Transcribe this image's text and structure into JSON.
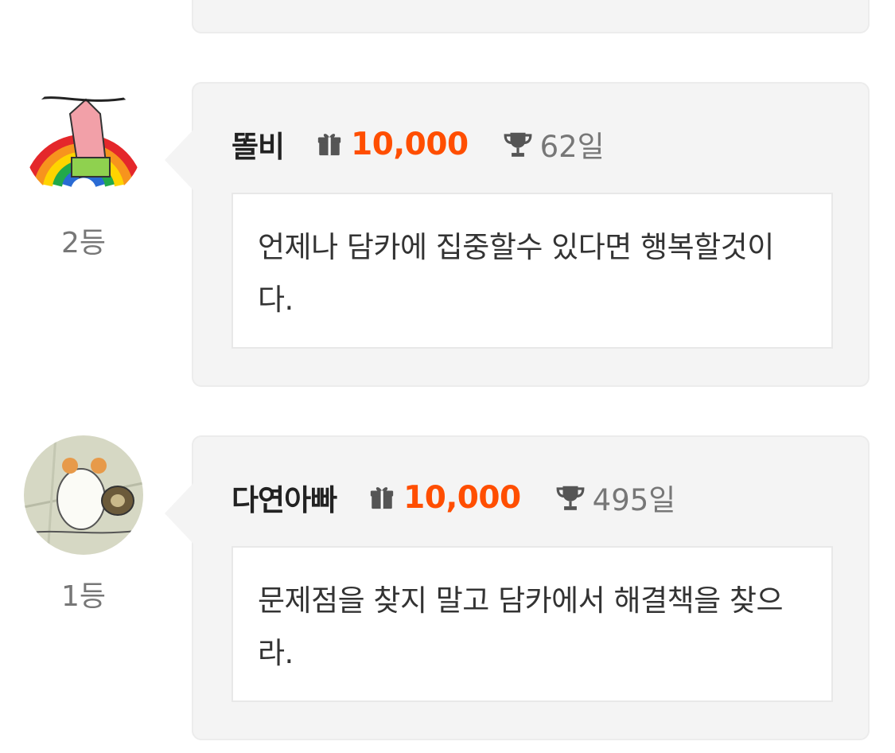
{
  "entries": [
    {
      "rank": "2등",
      "author": "똘비",
      "reward": "10,000",
      "days": "62일",
      "message": "언제나 담카에 집중할수 있다면 행복할것이다."
    },
    {
      "rank": "1등",
      "author": "다연아빠",
      "reward": "10,000",
      "days": "495일",
      "message": "문제점을 찾지 말고 담카에서 해결책을 찾으라."
    }
  ],
  "colors": {
    "accent": "#ff4e00",
    "card_bg": "#f4f4f4",
    "muted": "#777777"
  },
  "icons": {
    "reward": "gift-icon",
    "days": "trophy-icon"
  }
}
